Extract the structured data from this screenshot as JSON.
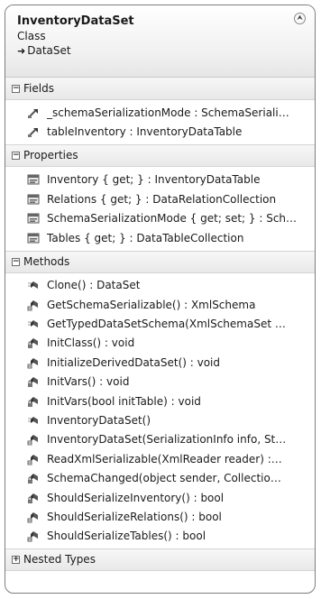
{
  "class_shape": {
    "name": "InventoryDataSet",
    "kind": "Class",
    "base_arrow": "➜",
    "base": "DataSet",
    "collapse_glyph": "⮝"
  },
  "sections": {
    "fields": {
      "label": "Fields",
      "toggle": "−",
      "items": [
        {
          "text": "_schemaSerializationMode : SchemaSeriali…",
          "icon": "field-icon"
        },
        {
          "text": "tableInventory : InventoryDataTable",
          "icon": "field-icon"
        }
      ]
    },
    "properties": {
      "label": "Properties",
      "toggle": "−",
      "items": [
        {
          "text": "Inventory { get; } : InventoryDataTable",
          "icon": "property-icon"
        },
        {
          "text": "Relations { get; } : DataRelationCollection",
          "icon": "property-icon"
        },
        {
          "text": "SchemaSerializationMode { get; set; } : Sch…",
          "icon": "property-icon"
        },
        {
          "text": "Tables { get; } : DataTableCollection",
          "icon": "property-icon"
        }
      ]
    },
    "methods": {
      "label": "Methods",
      "toggle": "−",
      "items": [
        {
          "text": "Clone() : DataSet",
          "icon": "public-method-icon"
        },
        {
          "text": "GetSchemaSerializable() : XmlSchema",
          "icon": "protected-method-icon"
        },
        {
          "text": "GetTypedDataSetSchema(XmlSchemaSet …",
          "icon": "public-method-icon"
        },
        {
          "text": "InitClass() : void",
          "icon": "private-method-icon"
        },
        {
          "text": "InitializeDerivedDataSet() : void",
          "icon": "protected-method-icon"
        },
        {
          "text": "InitVars() : void",
          "icon": "private-method-icon"
        },
        {
          "text": "InitVars(bool initTable) : void",
          "icon": "private-method-icon"
        },
        {
          "text": "InventoryDataSet()",
          "icon": "public-method-icon"
        },
        {
          "text": "InventoryDataSet(SerializationInfo info, St…",
          "icon": "protected-method-icon"
        },
        {
          "text": "ReadXmlSerializable(XmlReader reader) :…",
          "icon": "protected-method-icon"
        },
        {
          "text": "SchemaChanged(object sender, Collectio…",
          "icon": "private-method-icon"
        },
        {
          "text": "ShouldSerializeInventory() : bool",
          "icon": "private-method-icon"
        },
        {
          "text": "ShouldSerializeRelations() : bool",
          "icon": "protected-method-icon"
        },
        {
          "text": "ShouldSerializeTables() : bool",
          "icon": "protected-method-icon"
        }
      ]
    },
    "nested_types": {
      "label": "Nested Types",
      "toggle": "+"
    }
  }
}
